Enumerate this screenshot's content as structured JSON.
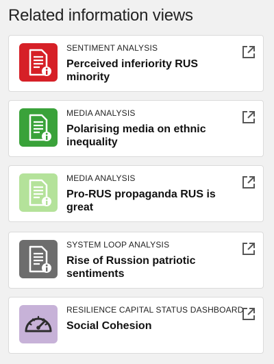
{
  "header": {
    "title": "Related information views"
  },
  "cards": [
    {
      "category": "SENTIMENT ANALYSIS",
      "title": "Perceived inferiority RUS minority",
      "icon": "document-info-icon",
      "color": "#d62027"
    },
    {
      "category": "MEDIA ANALYSIS",
      "title": "Polarising media on ethnic inequality",
      "icon": "document-info-icon",
      "color": "#3aa23a"
    },
    {
      "category": "MEDIA ANALYSIS",
      "title": "Pro-RUS propaganda RUS is great",
      "icon": "document-info-icon",
      "color": "#b4e29a"
    },
    {
      "category": "SYSTEM LOOP ANALYSIS",
      "title": "Rise of Russion patriotic sentiments",
      "icon": "document-info-icon",
      "color": "#6d6d6d"
    },
    {
      "category": "RESILIENCE CAPITAL STATUS DASHBOARD",
      "title": "Social Cohesion",
      "icon": "gauge-icon",
      "color": "#c7b2d8"
    }
  ]
}
